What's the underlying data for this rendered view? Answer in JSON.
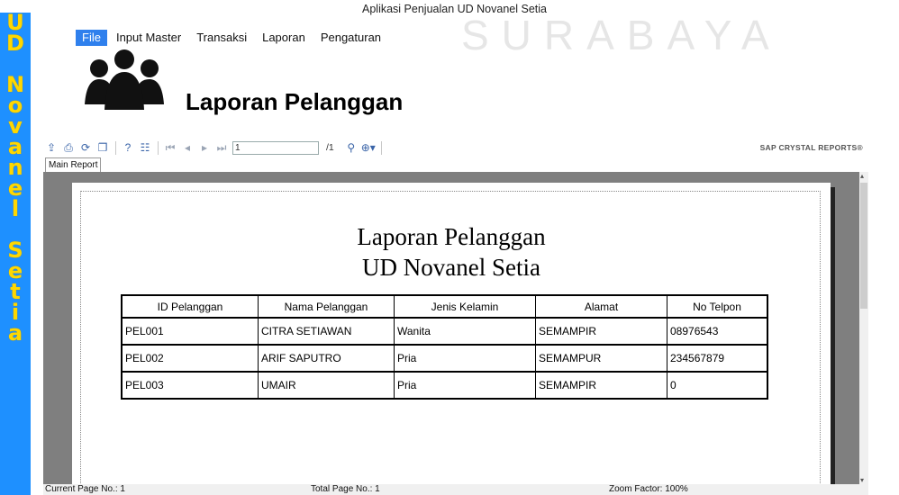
{
  "side_banner": {
    "lines": [
      "UD",
      "Novanel",
      "Setia"
    ]
  },
  "watermark": "SURABAYA",
  "app_title": "Aplikasi Penjualan UD Novanel Setia",
  "menu": [
    "File",
    "Input Master",
    "Transaksi",
    "Laporan",
    "Pengaturan"
  ],
  "header_title": "Laporan Pelanggan",
  "toolbar": {
    "page_value": "1",
    "page_total": "/1",
    "brand": "SAP CRYSTAL REPORTS®",
    "icons": [
      "export-icon",
      "print-icon",
      "refresh-icon",
      "copy-icon",
      "help-icon",
      "group-tree-icon",
      "first-page-icon",
      "prev-page-icon",
      "next-page-icon",
      "last-page-icon",
      "find-icon",
      "zoom-icon"
    ]
  },
  "tab_main_report": "Main Report",
  "report": {
    "title_line1": "Laporan Pelanggan",
    "title_line2": "UD Novanel Setia",
    "columns": [
      "ID Pelanggan",
      "Nama Pelanggan",
      "Jenis Kelamin",
      "Alamat",
      "No Telpon"
    ],
    "rows": [
      [
        "PEL001",
        "CITRA SETIAWAN",
        "Wanita",
        "SEMAMPIR",
        "08976543"
      ],
      [
        "PEL002",
        "ARIF SAPUTRO",
        "Pria",
        "SEMAMPUR",
        "234567879"
      ],
      [
        "PEL003",
        "UMAIR",
        "Pria",
        "SEMAMPIR",
        "0"
      ]
    ]
  },
  "status": {
    "current_page": "Current Page No.: 1",
    "total_page": "Total Page No.: 1",
    "zoom": "Zoom Factor: 100%"
  },
  "colors": {
    "banner_bg": "#1e90ff",
    "banner_text": "#ffd700",
    "menu_active": "#2f80ed"
  }
}
